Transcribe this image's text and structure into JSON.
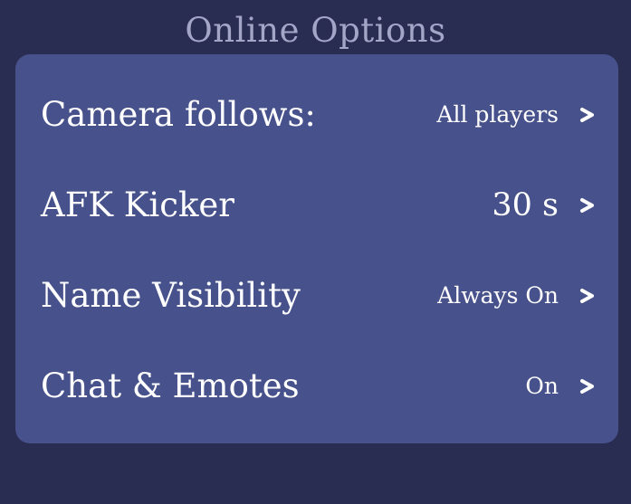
{
  "title": "Online Options",
  "colors": {
    "background": "#2a2d52",
    "panel": "#47518b",
    "title": "#a4a6c8",
    "text": "#ffffff"
  },
  "options": [
    {
      "label": "Camera follows:",
      "value": "All players",
      "icon": "chevron-right-icon"
    },
    {
      "label": "AFK Kicker",
      "value": "30 s",
      "icon": "chevron-right-icon"
    },
    {
      "label": "Name Visibility",
      "value": "Always On",
      "icon": "chevron-right-icon"
    },
    {
      "label": "Chat & Emotes",
      "value": "On",
      "icon": "chevron-right-icon"
    }
  ]
}
